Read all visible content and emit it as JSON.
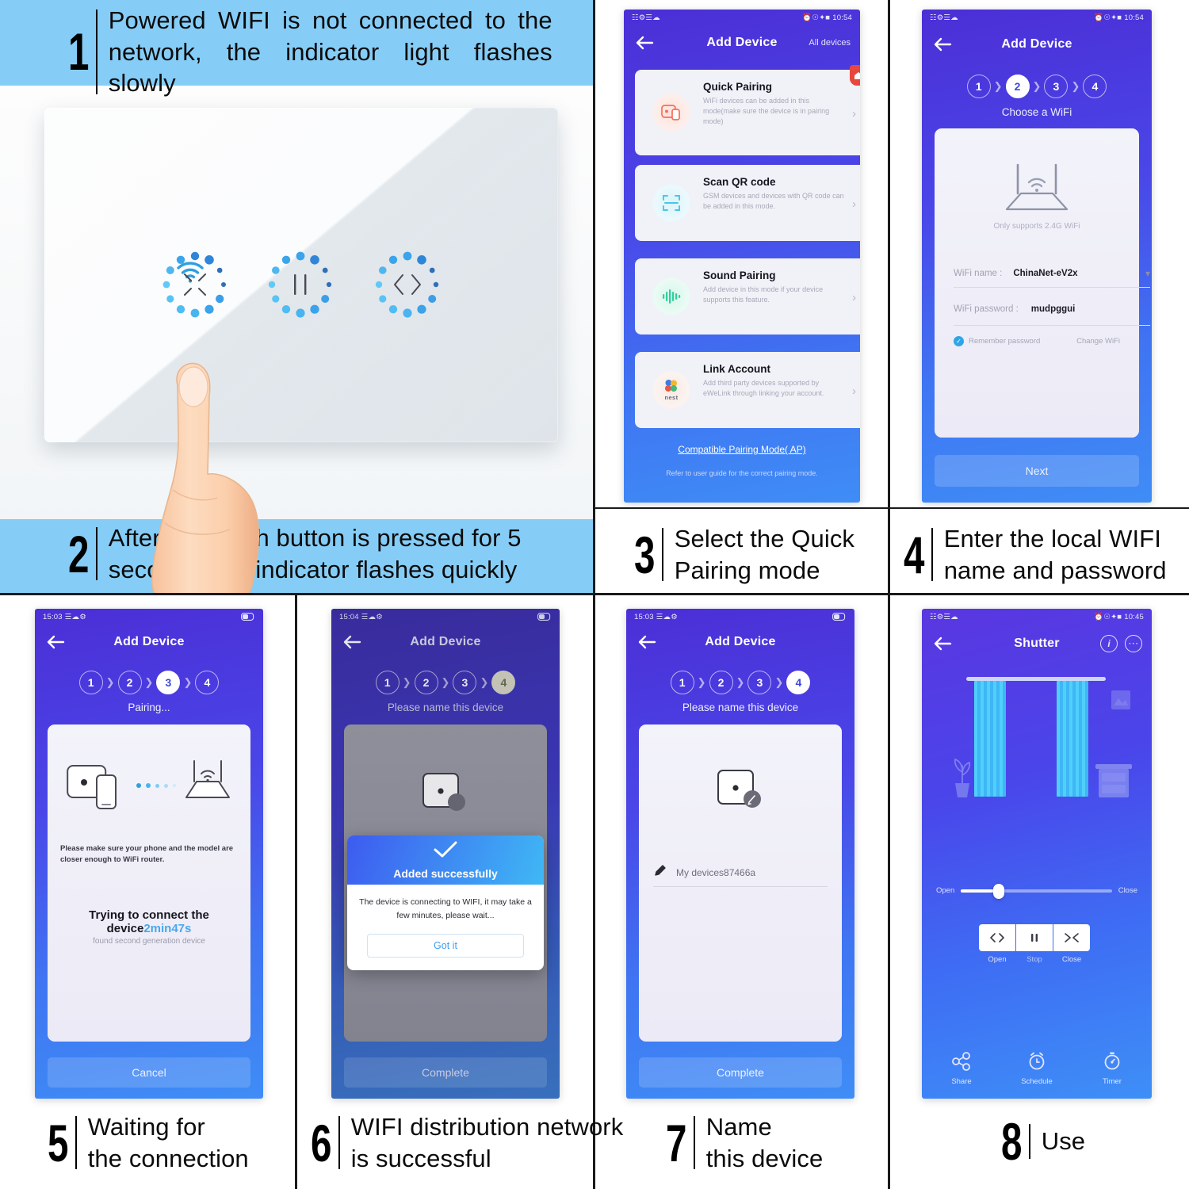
{
  "colors": {
    "caption_band": "#85cdf7",
    "phone_purple_start": "#4b2fd6",
    "phone_blue_end": "#2f7cf6",
    "accent_white": "#ffffff",
    "quick_pair_icon": "#f4705a",
    "qr_icon": "#49c6e8",
    "sound_icon": "#2fcf9e",
    "link_badge": "#e8473d",
    "curtain_blue": "#3fc3f7"
  },
  "steps": [
    {
      "number": "1",
      "caption": "Powered WIFI is not connected to the network, the indicator light flashes slowly"
    },
    {
      "number": "2",
      "caption": "After the touch button is pressed for 5 seconds, the indicator flashes quickly"
    },
    {
      "number": "3",
      "caption_line1": "Select the Quick",
      "caption_line2": "Pairing mode"
    },
    {
      "number": "4",
      "caption_line1": "Enter  the  local  WIFI",
      "caption_line2": "name and password"
    },
    {
      "number": "5",
      "caption_line1": "Waiting for",
      "caption_line2": "the connection"
    },
    {
      "number": "6",
      "caption_line1": "WIFI distribution network",
      "caption_line2": "is successful"
    },
    {
      "number": "7",
      "caption_line1": "Name",
      "caption_line2": "this device"
    },
    {
      "number": "8",
      "caption_line1": "Use",
      "caption_line2": ""
    }
  ],
  "switch_panel": {
    "wifi_indicator": "wifi-icon",
    "buttons": [
      {
        "icon": "close-touch-icon",
        "state": "flashing"
      },
      {
        "icon": "stop-touch-icon",
        "state": "idle"
      },
      {
        "icon": "open-touch-icon",
        "state": "idle"
      }
    ]
  },
  "screen3": {
    "statusbar": {
      "time": "10:54"
    },
    "nav": {
      "title": "Add Device",
      "right_action": "All devices"
    },
    "modes": [
      {
        "title": "Quick Pairing",
        "desc": "WiFi devices can be added in this mode(make sure the device is in pairing mode)",
        "icon": "quick-pairing-icon",
        "badge": "home-badge-icon"
      },
      {
        "title": "Scan QR code",
        "desc": "GSM devices and devices with QR code can be added in this mode.",
        "icon": "qr-scan-icon",
        "badge": ""
      },
      {
        "title": "Sound Pairing",
        "desc": "Add device in this mode if your device supports this feature.",
        "icon": "sound-wave-icon",
        "badge": ""
      },
      {
        "title": "Link Account",
        "desc": "Add third party devices supported by eWeLink through linking your account.",
        "icon": "nest-icon",
        "badge": ""
      }
    ],
    "compatible_link": "Compatible Pairing Mode( AP)",
    "footnote": "Refer to user guide for the correct pairing mode."
  },
  "screen4": {
    "statusbar": {
      "time": "10:54"
    },
    "nav": {
      "title": "Add Device"
    },
    "step_circles": [
      "1",
      "2",
      "3",
      "4"
    ],
    "active_step": "2",
    "substep": "Choose a WiFi",
    "router_hint": "Only supports 2.4G WiFi",
    "wifi_name_label": "WiFi name :",
    "wifi_name_value": "ChinaNet-eV2x",
    "wifi_pass_label": "WiFi password :",
    "wifi_pass_value": "mudpggui",
    "remember_label": "Remember password",
    "change_wifi": "Change WiFi",
    "next_button": "Next"
  },
  "screen5": {
    "statusbar": {
      "time": "15:03"
    },
    "nav": {
      "title": "Add Device"
    },
    "step_circles": [
      "1",
      "2",
      "3",
      "4"
    ],
    "active_step": "3",
    "substep": "Pairing...",
    "hint": "Please make sure your phone and the model are closer enough to WiFi router.",
    "trying_text": "Trying to connect the device",
    "countdown": "2min47s",
    "found_text": "found second generation device",
    "cancel_button": "Cancel"
  },
  "screen6": {
    "statusbar": {
      "time": "15:04"
    },
    "nav": {
      "title": "Add Device"
    },
    "step_circles": [
      "1",
      "2",
      "3",
      "4"
    ],
    "active_step": "4",
    "substep": "Please name this device",
    "dialog": {
      "icon": "check-icon",
      "title": "Added successfully",
      "message": "The device is connecting to WIFI, it may take a few minutes, please wait...",
      "ok_button": "Got it"
    },
    "complete_button": "Complete"
  },
  "screen7": {
    "statusbar": {
      "time": "15:03"
    },
    "nav": {
      "title": "Add Device"
    },
    "step_circles": [
      "1",
      "2",
      "3",
      "4"
    ],
    "active_step": "4",
    "substep": "Please name this device",
    "device_name": "My devices87466a",
    "edit_icon": "pencil-icon",
    "complete_button": "Complete"
  },
  "screen8": {
    "statusbar": {
      "time": "10:45"
    },
    "nav": {
      "title": "Shutter",
      "info_icon": "info-icon",
      "more_icon": "more-icon"
    },
    "slider": {
      "left_label": "Open",
      "right_label": "Close",
      "position_percent": 20
    },
    "controls": [
      {
        "label": "Open",
        "icon": "open-arrows-icon"
      },
      {
        "label": "Stop",
        "icon": "pause-icon"
      },
      {
        "label": "Close",
        "icon": "close-arrows-icon"
      }
    ],
    "bottom_actions": [
      {
        "label": "Share",
        "icon": "share-icon"
      },
      {
        "label": "Schedule",
        "icon": "alarm-clock-icon"
      },
      {
        "label": "Timer",
        "icon": "stopwatch-icon"
      }
    ]
  }
}
